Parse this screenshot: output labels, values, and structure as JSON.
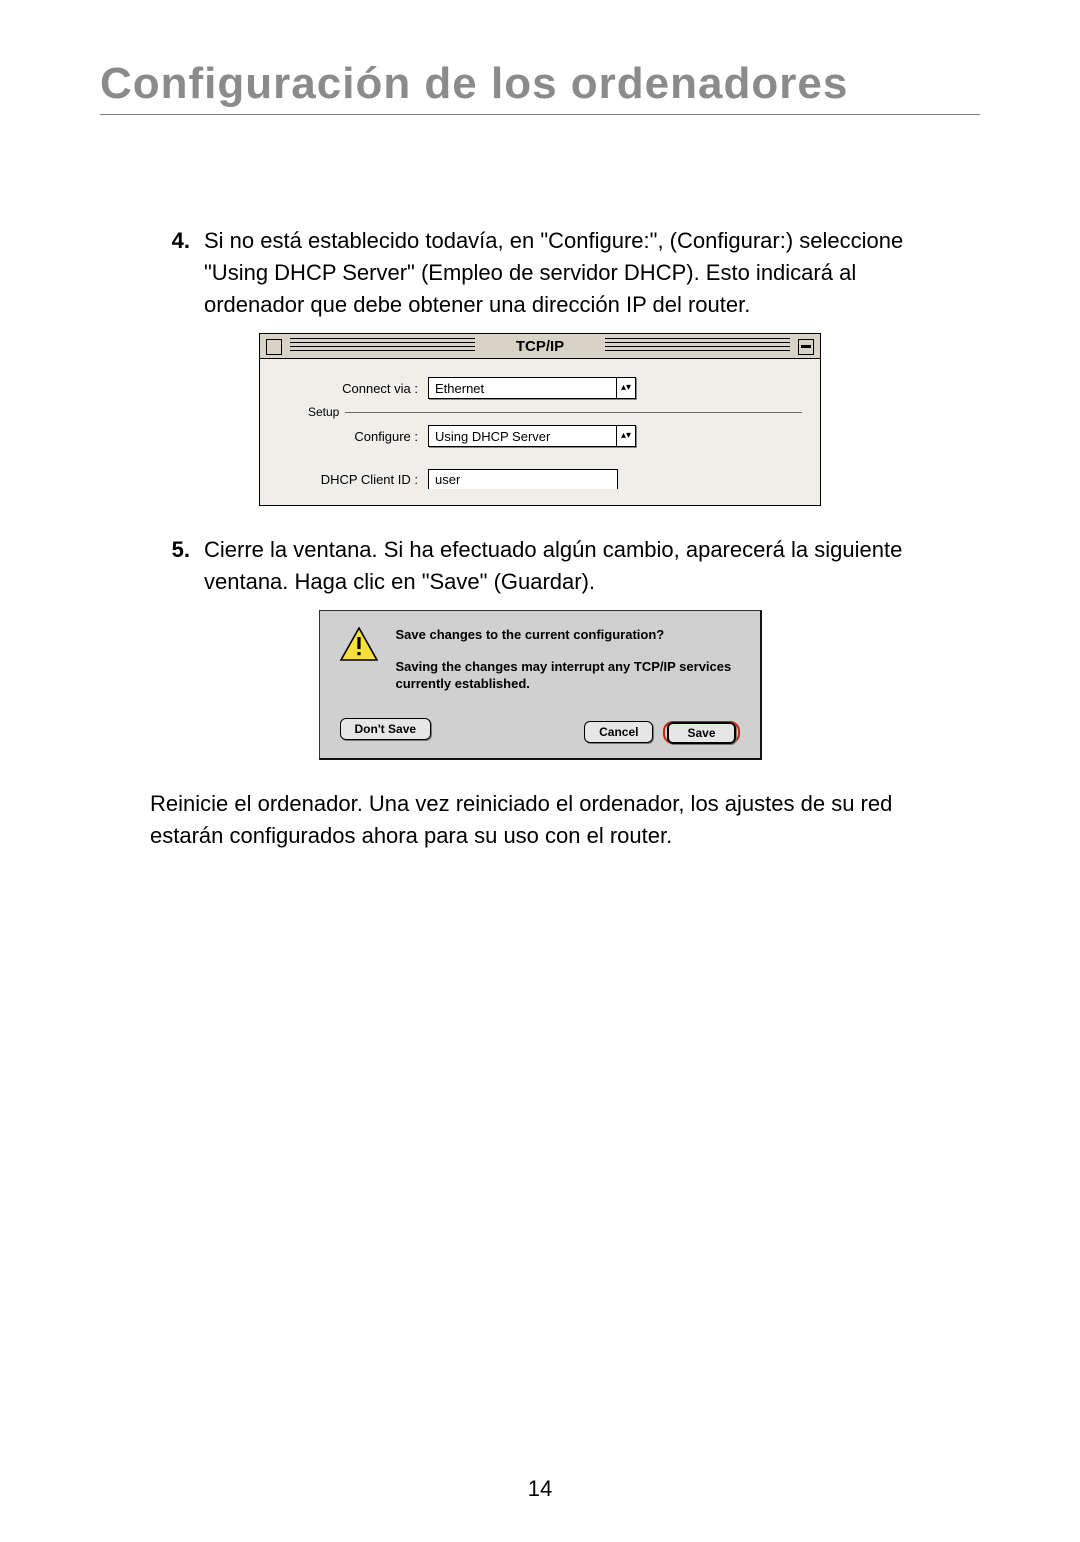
{
  "page": {
    "title": "Configuración de los ordenadores",
    "number": "14"
  },
  "step4": {
    "num": "4.",
    "text": "Si no está establecido todavía, en \"Configure:\", (Configurar:) seleccione \"Using DHCP Server\" (Empleo de servidor DHCP). Esto indicará al ordenador que debe obtener una dirección IP del router."
  },
  "tcpip": {
    "window_title": "TCP/IP",
    "labels": {
      "connect_via": "Connect via :",
      "setup": "Setup",
      "configure": "Configure :",
      "dhcp_client_id": "DHCP Client ID :"
    },
    "values": {
      "connect_via": "Ethernet",
      "configure": "Using DHCP Server",
      "dhcp_client_id": "user"
    }
  },
  "step5": {
    "num": "5.",
    "text": "Cierre la ventana. Si ha efectuado algún cambio, aparecerá la siguiente ventana. Haga clic en \"Save\" (Guardar)."
  },
  "alert": {
    "title": "Save changes to the current configuration?",
    "subtitle": "Saving the changes may interrupt any TCP/IP services currently established.",
    "buttons": {
      "dont_save": "Don't Save",
      "cancel": "Cancel",
      "save": "Save"
    }
  },
  "closing_text": "Reinicie el ordenador. Una vez reiniciado el ordenador, los ajustes de su red estarán configurados ahora para su uso con el router."
}
